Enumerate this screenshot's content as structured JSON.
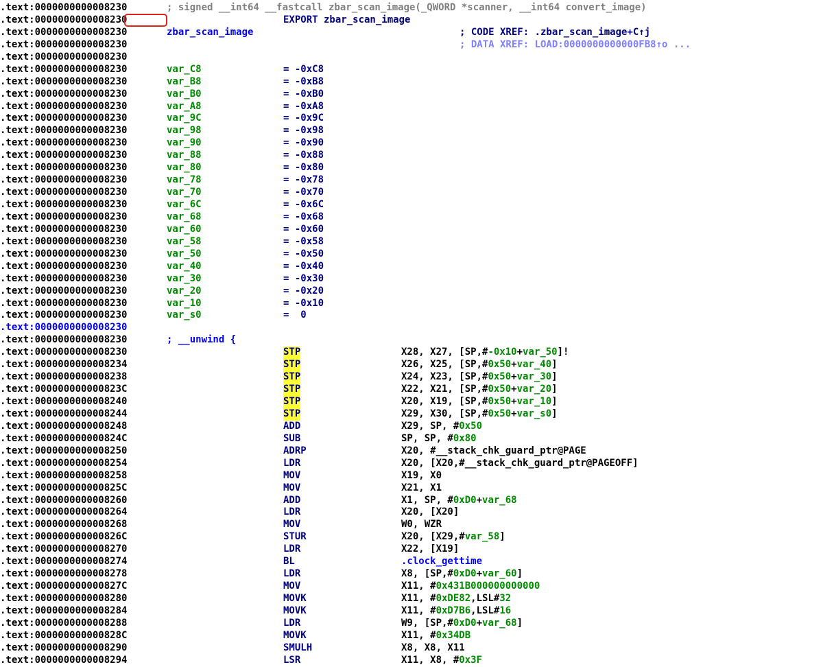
{
  "lines": [
    {
      "addr": ".text:0000000000008230",
      "comment_top": "; signed __int64 __fastcall zbar_scan_image(_QWORD *scanner, __int64 convert_image)"
    },
    {
      "addr": ".text:0000000000008230",
      "export": "EXPORT zbar_scan_image"
    },
    {
      "addr": ".text:0000000000008230",
      "name": "zbar_scan_image",
      "name_color": "blue",
      "xref": "; CODE XREF: .zbar_scan_image+C↑j",
      "xref_color": "navy"
    },
    {
      "addr": ".text:0000000000008230",
      "xref": "; DATA XREF: LOAD:0000000000000FB8↑o ...",
      "xref_color": "lightblue"
    },
    {
      "addr": ".text:0000000000008230"
    },
    {
      "addr": ".text:0000000000008230",
      "name": "var_C8",
      "eq": "= -0xC8"
    },
    {
      "addr": ".text:0000000000008230",
      "name": "var_B8",
      "eq": "= -0xB8"
    },
    {
      "addr": ".text:0000000000008230",
      "name": "var_B0",
      "eq": "= -0xB0"
    },
    {
      "addr": ".text:0000000000008230",
      "name": "var_A8",
      "eq": "= -0xA8"
    },
    {
      "addr": ".text:0000000000008230",
      "name": "var_9C",
      "eq": "= -0x9C"
    },
    {
      "addr": ".text:0000000000008230",
      "name": "var_98",
      "eq": "= -0x98"
    },
    {
      "addr": ".text:0000000000008230",
      "name": "var_90",
      "eq": "= -0x90"
    },
    {
      "addr": ".text:0000000000008230",
      "name": "var_88",
      "eq": "= -0x88"
    },
    {
      "addr": ".text:0000000000008230",
      "name": "var_80",
      "eq": "= -0x80"
    },
    {
      "addr": ".text:0000000000008230",
      "name": "var_78",
      "eq": "= -0x78"
    },
    {
      "addr": ".text:0000000000008230",
      "name": "var_70",
      "eq": "= -0x70"
    },
    {
      "addr": ".text:0000000000008230",
      "name": "var_6C",
      "eq": "= -0x6C"
    },
    {
      "addr": ".text:0000000000008230",
      "name": "var_68",
      "eq": "= -0x68"
    },
    {
      "addr": ".text:0000000000008230",
      "name": "var_60",
      "eq": "= -0x60"
    },
    {
      "addr": ".text:0000000000008230",
      "name": "var_58",
      "eq": "= -0x58"
    },
    {
      "addr": ".text:0000000000008230",
      "name": "var_50",
      "eq": "= -0x50"
    },
    {
      "addr": ".text:0000000000008230",
      "name": "var_40",
      "eq": "= -0x40"
    },
    {
      "addr": ".text:0000000000008230",
      "name": "var_30",
      "eq": "= -0x30"
    },
    {
      "addr": ".text:0000000000008230",
      "name": "var_20",
      "eq": "= -0x20"
    },
    {
      "addr": ".text:0000000000008230",
      "name": "var_10",
      "eq": "= -0x10"
    },
    {
      "addr": ".text:0000000000008230",
      "name": "var_s0",
      "eq": "=  0"
    },
    {
      "addr": ".text:0000000000008230",
      "addr_color": "blue"
    },
    {
      "addr": ".text:0000000000008230",
      "name": "; __unwind {",
      "name_color": "blue"
    },
    {
      "addr": ".text:0000000000008230",
      "mn": "STP",
      "hl": true,
      "ops": [
        [
          "X28, X27, [SP,#",
          "black"
        ],
        [
          "-0x10",
          "green"
        ],
        [
          "+",
          "black"
        ],
        [
          "var_50",
          "green"
        ],
        [
          "]!",
          "black"
        ]
      ]
    },
    {
      "addr": ".text:0000000000008234",
      "mn": "STP",
      "hl": true,
      "ops": [
        [
          "X26, X25, [SP,#",
          "black"
        ],
        [
          "0x50",
          "green"
        ],
        [
          "+",
          "black"
        ],
        [
          "var_40",
          "green"
        ],
        [
          "]",
          "black"
        ]
      ]
    },
    {
      "addr": ".text:0000000000008238",
      "mn": "STP",
      "hl": true,
      "ops": [
        [
          "X24, X23, [SP,#",
          "black"
        ],
        [
          "0x50",
          "green"
        ],
        [
          "+",
          "black"
        ],
        [
          "var_30",
          "green"
        ],
        [
          "]",
          "black"
        ]
      ]
    },
    {
      "addr": ".text:000000000000823C",
      "mn": "STP",
      "hl": true,
      "ops": [
        [
          "X22, X21, [SP,#",
          "black"
        ],
        [
          "0x50",
          "green"
        ],
        [
          "+",
          "black"
        ],
        [
          "var_20",
          "green"
        ],
        [
          "]",
          "black"
        ]
      ]
    },
    {
      "addr": ".text:0000000000008240",
      "mn": "STP",
      "hl": true,
      "ops": [
        [
          "X20, X19, [SP,#",
          "black"
        ],
        [
          "0x50",
          "green"
        ],
        [
          "+",
          "black"
        ],
        [
          "var_10",
          "green"
        ],
        [
          "]",
          "black"
        ]
      ]
    },
    {
      "addr": ".text:0000000000008244",
      "mn": "STP",
      "hl": true,
      "ops": [
        [
          "X29, X30, [SP,#",
          "black"
        ],
        [
          "0x50",
          "green"
        ],
        [
          "+",
          "black"
        ],
        [
          "var_s0",
          "green"
        ],
        [
          "]",
          "black"
        ]
      ]
    },
    {
      "addr": ".text:0000000000008248",
      "mn": "ADD",
      "ops": [
        [
          "X29, SP, #",
          "black"
        ],
        [
          "0x50",
          "green"
        ]
      ]
    },
    {
      "addr": ".text:000000000000824C",
      "mn": "SUB",
      "ops": [
        [
          "SP, SP, #",
          "black"
        ],
        [
          "0x80",
          "green"
        ]
      ]
    },
    {
      "addr": ".text:0000000000008250",
      "mn": "ADRP",
      "ops": [
        [
          "X20, #__stack_chk_guard_ptr@PAGE",
          "black"
        ]
      ]
    },
    {
      "addr": ".text:0000000000008254",
      "mn": "LDR",
      "ops": [
        [
          "X20, [X20,#__stack_chk_guard_ptr@PAGEOFF]",
          "black"
        ]
      ]
    },
    {
      "addr": ".text:0000000000008258",
      "mn": "MOV",
      "ops": [
        [
          "X19, X0",
          "black"
        ]
      ]
    },
    {
      "addr": ".text:000000000000825C",
      "mn": "MOV",
      "ops": [
        [
          "X21, X1",
          "black"
        ]
      ]
    },
    {
      "addr": ".text:0000000000008260",
      "mn": "ADD",
      "ops": [
        [
          "X1, SP, #",
          "black"
        ],
        [
          "0xD0",
          "green"
        ],
        [
          "+",
          "black"
        ],
        [
          "var_68",
          "green"
        ]
      ]
    },
    {
      "addr": ".text:0000000000008264",
      "mn": "LDR",
      "ops": [
        [
          "X20, [X20]",
          "black"
        ]
      ]
    },
    {
      "addr": ".text:0000000000008268",
      "mn": "MOV",
      "ops": [
        [
          "W0, WZR",
          "black"
        ]
      ]
    },
    {
      "addr": ".text:000000000000826C",
      "mn": "STUR",
      "ops": [
        [
          "X20, [X29,#",
          "black"
        ],
        [
          "var_58",
          "green"
        ],
        [
          "]",
          "black"
        ]
      ]
    },
    {
      "addr": ".text:0000000000008270",
      "mn": "LDR",
      "ops": [
        [
          "X22, [X19]",
          "black"
        ]
      ]
    },
    {
      "addr": ".text:0000000000008274",
      "mn": "BL",
      "ops": [
        [
          ".clock_gettime",
          "blue"
        ]
      ]
    },
    {
      "addr": ".text:0000000000008278",
      "mn": "LDR",
      "ops": [
        [
          "X8, [SP,#",
          "black"
        ],
        [
          "0xD0",
          "green"
        ],
        [
          "+",
          "black"
        ],
        [
          "var_60",
          "green"
        ],
        [
          "]",
          "black"
        ]
      ]
    },
    {
      "addr": ".text:000000000000827C",
      "mn": "MOV",
      "ops": [
        [
          "X11, #",
          "black"
        ],
        [
          "0x431B000000000000",
          "green"
        ]
      ]
    },
    {
      "addr": ".text:0000000000008280",
      "mn": "MOVK",
      "ops": [
        [
          "X11, #",
          "black"
        ],
        [
          "0xDE82",
          "green"
        ],
        [
          ",LSL#",
          "black"
        ],
        [
          "32",
          "green"
        ]
      ]
    },
    {
      "addr": ".text:0000000000008284",
      "mn": "MOVK",
      "ops": [
        [
          "X11, #",
          "black"
        ],
        [
          "0xD7B6",
          "green"
        ],
        [
          ",LSL#",
          "black"
        ],
        [
          "16",
          "green"
        ]
      ]
    },
    {
      "addr": ".text:0000000000008288",
      "mn": "LDR",
      "ops": [
        [
          "W9, [SP,#",
          "black"
        ],
        [
          "0xD0",
          "green"
        ],
        [
          "+",
          "black"
        ],
        [
          "var_68",
          "green"
        ],
        [
          "]",
          "black"
        ]
      ]
    },
    {
      "addr": ".text:000000000000828C",
      "mn": "MOVK",
      "ops": [
        [
          "X11, #",
          "black"
        ],
        [
          "0x34DB",
          "green"
        ]
      ]
    },
    {
      "addr": ".text:0000000000008290",
      "mn": "SMULH",
      "ops": [
        [
          "X8, X8, X11",
          "black"
        ]
      ]
    },
    {
      "addr": ".text:0000000000008294",
      "mn": "LSR",
      "ops": [
        [
          "X11, X8, #",
          "black"
        ],
        [
          "0x3F",
          "green"
        ]
      ]
    }
  ]
}
